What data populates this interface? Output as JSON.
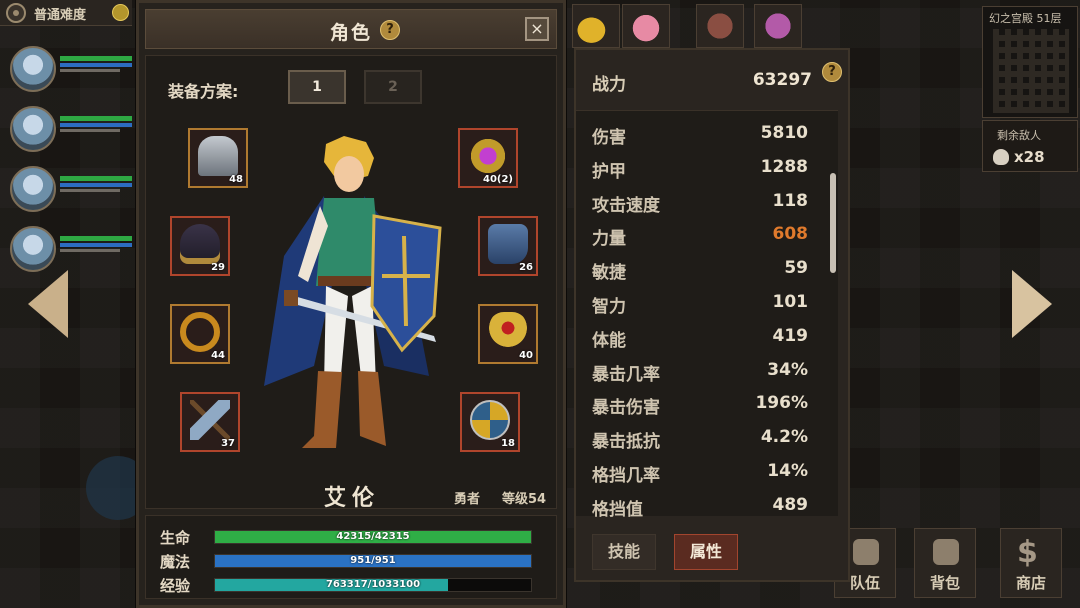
{
  "hud": {
    "difficulty": "普通难度",
    "floor": "幻之宫殿 51层",
    "enemies_label": "剩余敌人",
    "enemies_count": "x28",
    "bottom_buttons": [
      {
        "label": "队伍",
        "icon": "team-icon"
      },
      {
        "label": "背包",
        "icon": "bag-icon"
      },
      {
        "label": "商店",
        "icon": "shop-icon"
      }
    ],
    "top_items": [
      "feather-icon",
      "pig-icon",
      "armor-icon",
      "ornament-icon"
    ]
  },
  "character_panel": {
    "title": "角色",
    "close_icon": "×",
    "help_icon": "?",
    "loadout_label": "装备方案:",
    "loadouts": [
      "1",
      "2"
    ],
    "active_loadout": "1",
    "equipment": [
      {
        "slot": "helmet",
        "icon": "helmet-icon",
        "level": "48"
      },
      {
        "slot": "amulet",
        "icon": "orb-icon",
        "level": "40(2)"
      },
      {
        "slot": "shoulders",
        "icon": "shoulder-icon",
        "level": "29"
      },
      {
        "slot": "boots",
        "icon": "boots-icon",
        "level": "26"
      },
      {
        "slot": "ring1",
        "icon": "ring-icon",
        "level": "44"
      },
      {
        "slot": "ring2",
        "icon": "rune-ring-icon",
        "level": "40"
      },
      {
        "slot": "weapon",
        "icon": "axe-icon",
        "level": "37"
      },
      {
        "slot": "shield",
        "icon": "round-shield-icon",
        "level": "18"
      }
    ],
    "hero": {
      "name": "艾伦",
      "class": "勇者",
      "level": "等级54"
    },
    "bars": [
      {
        "label": "生命",
        "text": "42315/42315",
        "current": 42315,
        "max": 42315,
        "color": "#2fae46"
      },
      {
        "label": "魔法",
        "text": "951/951",
        "current": 951,
        "max": 951,
        "color": "#2a72c4"
      },
      {
        "label": "经验",
        "text": "763317/1033100",
        "current": 763317,
        "max": 1033100,
        "color": "#23a7a0"
      }
    ]
  },
  "stats_panel": {
    "power_label": "战力",
    "power_value": "63297",
    "help_icon": "?",
    "stats": [
      {
        "name": "伤害",
        "value": "5810"
      },
      {
        "name": "护甲",
        "value": "1288"
      },
      {
        "name": "攻击速度",
        "value": "118"
      },
      {
        "name": "力量",
        "value": "608",
        "color": "#e07a2c"
      },
      {
        "name": "敏捷",
        "value": "59"
      },
      {
        "name": "智力",
        "value": "101"
      },
      {
        "name": "体能",
        "value": "419"
      },
      {
        "name": "暴击几率",
        "value": "34%"
      },
      {
        "name": "暴击伤害",
        "value": "196%"
      },
      {
        "name": "暴击抵抗",
        "value": "4.2%"
      },
      {
        "name": "格挡几率",
        "value": "14%"
      },
      {
        "name": "格挡值",
        "value": "489"
      }
    ],
    "tabs": [
      {
        "label": "技能",
        "active": false
      },
      {
        "label": "属性",
        "active": true
      }
    ]
  }
}
